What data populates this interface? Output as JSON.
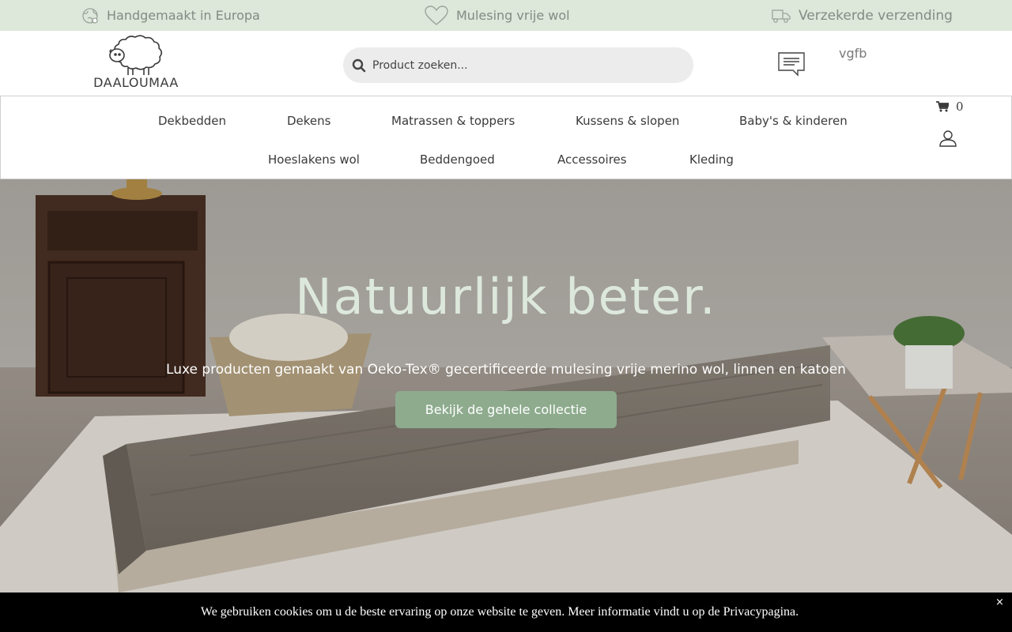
{
  "usp_bar": {
    "items": [
      {
        "icon": "globe-icon",
        "label": "Handgemaakt in Europa"
      },
      {
        "icon": "heart-icon",
        "label": "Mulesing vrije wol"
      },
      {
        "icon": "truck-icon",
        "label": "Verzekerde verzending"
      }
    ]
  },
  "header": {
    "logo_text": "DAALOUMAA",
    "search_placeholder": "Product zoeken...",
    "chat_icon": "chat-bubble-icon",
    "vgfb": "vgfb"
  },
  "nav": {
    "items": [
      "Dekbedden",
      "Dekens",
      "Matrassen & toppers",
      "Kussens & slopen",
      "Baby's & kinderen",
      "Hoeslakens wol",
      "Beddengoed",
      "Accessoires",
      "Kleding"
    ],
    "cart_count": "0",
    "cart_icon": "cart-icon",
    "user_icon": "user-icon"
  },
  "hero": {
    "title": "Natuurlijk beter.",
    "subtitle": "Luxe producten gemaakt van Oeko-Tex® gecertificeerde mulesing vrije merino wol, linnen en katoen",
    "button": "Bekijk de gehele collectie"
  },
  "cookie": {
    "text": "We gebruiken cookies om u de beste ervaring op onze website te geven. Meer informatie vindt u op de Privacypagina.",
    "close": "×"
  },
  "colors": {
    "usp_bg": "#dde7da",
    "accent_green": "#8eab8e",
    "hero_title": "#dde8dc"
  }
}
